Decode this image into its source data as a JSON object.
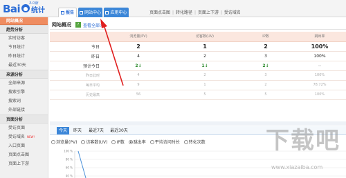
{
  "brand": {
    "logo_text": "Bai",
    "product": "统计",
    "version": "3.0版"
  },
  "top_tabs": [
    {
      "label": "报告"
    },
    {
      "label": "网站中心"
    },
    {
      "label": "应用中心"
    }
  ],
  "top_links": [
    "页面点击图",
    "转化路径",
    "页面上下游",
    "受访域名"
  ],
  "sidebar": {
    "overview": "网站概况",
    "groups": [
      {
        "title": "趋势分析",
        "items": [
          "实时访客",
          "今日统计",
          "昨日统计",
          "最近30天"
        ]
      },
      {
        "title": "来源分析",
        "items": [
          "全部来源",
          "搜索引擎",
          "搜索词",
          "外部链接"
        ]
      },
      {
        "title": "页面分析",
        "items": [
          "受访页面",
          "受访域名",
          "入口页面",
          "页面点击图",
          "页面上下游"
        ]
      }
    ],
    "new_badge": "NEW!"
  },
  "main": {
    "title": "网站概况",
    "view_all": "查看全部>>"
  },
  "stats": {
    "headers": [
      "",
      "浏览量(PV)",
      "访客数(UV)",
      "IP数",
      "跳出率"
    ],
    "rows": [
      {
        "label": "今日",
        "values": [
          "2",
          "1",
          "2",
          "100%"
        ]
      },
      {
        "label": "昨日",
        "values": [
          "4",
          "2",
          "3",
          "100%"
        ]
      },
      {
        "label": "预计今日",
        "values": [
          "2",
          "1",
          "2",
          "--"
        ]
      },
      {
        "label": "昨日此时",
        "values": [
          "4",
          "2",
          "3",
          "100%"
        ]
      },
      {
        "label": "每日平均",
        "values": [
          "9",
          "1",
          "2",
          "78.72%"
        ]
      },
      {
        "label": "历史最高",
        "values": [
          "56",
          "5",
          "5",
          "100%"
        ]
      }
    ]
  },
  "range_tabs": [
    "今天",
    "昨天",
    "最近7天",
    "最近30天"
  ],
  "metrics": {
    "options": [
      "浏览量(PV)",
      "访客数(UV)",
      "IP数",
      "跳出率",
      "平均访问时长",
      "转化次数"
    ],
    "selected": "跳出率"
  },
  "chart_data": {
    "type": "line",
    "y_ticks": [
      "100 %",
      "80 %",
      "60 %",
      "40 %"
    ],
    "series": [
      {
        "values": [
          100,
          0
        ]
      }
    ]
  },
  "watermark": {
    "text": "下载吧",
    "url": "www.xiazaiba.com"
  },
  "colors": {
    "accent_blue": "#3b86d8",
    "active_orange": "#ef8c60",
    "table_header": "#fbe7df",
    "arrow_red": "#e01e1e"
  }
}
